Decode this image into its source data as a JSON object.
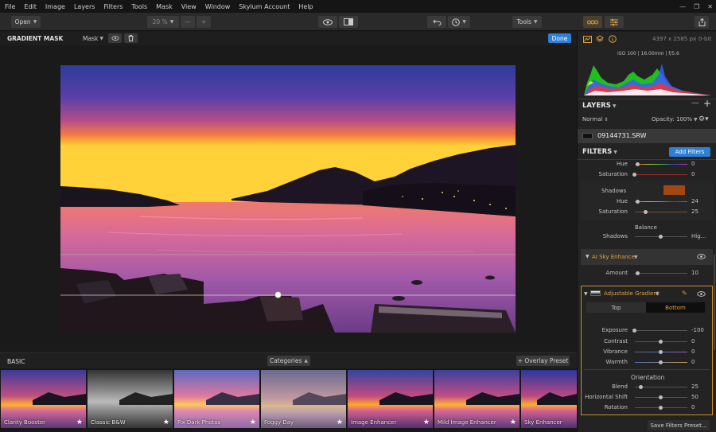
{
  "menu": [
    "File",
    "Edit",
    "Image",
    "Layers",
    "Filters",
    "Tools",
    "Mask",
    "View",
    "Window",
    "Skylum Account",
    "Help"
  ],
  "toolbar": {
    "open_label": "Open",
    "zoom_value": "20 %",
    "zoom_minus": "—",
    "zoom_plus": "+",
    "tools_label": "Tools"
  },
  "subheader": {
    "title": "GRADIENT MASK",
    "mask_label": "Mask",
    "done_label": "Done"
  },
  "filmstrip": {
    "section_label": "BASIC",
    "categories_label": "Categories",
    "overlay_label": "+ Overlay Preset",
    "presets": [
      "Clarity Booster",
      "Classic B&W",
      "Fix Dark Photos",
      "Foggy Day",
      "Image Enhancer",
      "Mild Image Enhancer",
      "Sky Enhancer"
    ]
  },
  "info": {
    "dimensions": "4397 x 2585 px",
    "bit_depth": "0-bit",
    "exif": "ISO 100  |  16.00mm  |  f/5.6"
  },
  "layers": {
    "title": "LAYERS",
    "blend_mode": "Normal",
    "opacity": "Opacity: 100%",
    "layer_name": "09144731.SRW"
  },
  "filters": {
    "title": "FILTERS",
    "add_label": "Add Filters",
    "top_rows": [
      {
        "label": "Hue",
        "value": "0",
        "pos": 0.5
      },
      {
        "label": "Saturation",
        "value": "0",
        "pos": 0.5
      }
    ],
    "shadows_label": "Shadows",
    "shadows_swatch": "#a24713",
    "shadow_rows": [
      {
        "label": "Hue",
        "value": "24",
        "pos": 0.05
      },
      {
        "label": "Saturation",
        "value": "25",
        "pos": 0.15
      }
    ],
    "balance_title": "Balance",
    "balance_row": {
      "label": "Shadows",
      "value": "Hig...",
      "pos": 0.5
    },
    "sky": {
      "title": "AI Sky Enhancer",
      "amount_label": "Amount",
      "amount_value": "10",
      "amount_pos": 0.1
    },
    "gradient": {
      "title": "Adjustable Gradient",
      "tab_top": "Top",
      "tab_bottom": "Bottom",
      "rows": [
        {
          "label": "Exposure",
          "value": "-100",
          "pos": 0.0
        },
        {
          "label": "Contrast",
          "value": "0",
          "pos": 0.5
        },
        {
          "label": "Vibrance",
          "value": "0",
          "pos": 0.5
        },
        {
          "label": "Warmth",
          "value": "0",
          "pos": 0.5
        }
      ],
      "orientation_title": "Orientation",
      "orientation_rows": [
        {
          "label": "Blend",
          "value": "25",
          "pos": 0.12
        },
        {
          "label": "Horizontal Shift",
          "value": "50",
          "pos": 0.5
        },
        {
          "label": "Rotation",
          "value": "0",
          "pos": 0.5
        }
      ]
    },
    "save_label": "Save Filters Preset..."
  },
  "colors": {
    "accent_blue": "#2f7fd6",
    "accent_orange": "#e2a03a"
  }
}
